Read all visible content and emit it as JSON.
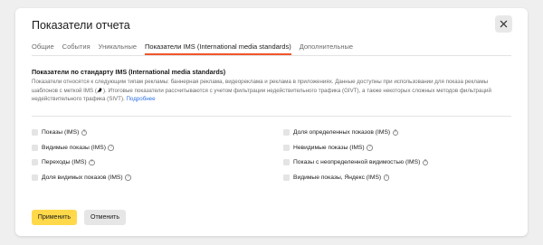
{
  "dialog": {
    "title": "Показатели отчета",
    "close_icon": "close-icon"
  },
  "tabs": [
    {
      "label": "Общие",
      "active": false
    },
    {
      "label": "События",
      "active": false
    },
    {
      "label": "Уникальные",
      "active": false
    },
    {
      "label": "Показатели IMS (International media standards)",
      "active": true
    },
    {
      "label": "Дополнительные",
      "active": false
    }
  ],
  "section": {
    "title": "Показатели по стандарту IMS (International media standards)",
    "description_part1": "Показатели относятся к следующим типам рекламы: баннерная реклама, видеореклама и реклама в приложениях. Данные доступны при использовании для показа рекламы шаблонов с меткой IMS (",
    "description_mark_icon": "ims-mark-icon",
    "description_part2": "). Итоговые показатели рассчитываются с учетом фильтрации недействительного трафика (GIVT), а также некоторых сложных методов фильтраций недействительного трафика (SIVT).",
    "link_label": "Подробнее"
  },
  "options_left": [
    {
      "label": "Показы (IMS)",
      "checked": false
    },
    {
      "label": "Видимые показы (IMS)",
      "checked": false
    },
    {
      "label": "Переходы (IMS)",
      "checked": false
    },
    {
      "label": "Доля видимых показов (IMS)",
      "checked": false
    }
  ],
  "options_right": [
    {
      "label": "Доля определенных показов (IMS)",
      "checked": false
    },
    {
      "label": "Невидимые показы (IMS)",
      "checked": false
    },
    {
      "label": "Показы с неопределенной видимостью (IMS)",
      "checked": false
    },
    {
      "label": "Видимые показы, Яндекс (IMS)",
      "checked": false
    }
  ],
  "buttons": {
    "apply_label": "Применить",
    "cancel_label": "Отменить"
  },
  "colors": {
    "accent_tab_underline": "#f0562c",
    "apply_button": "#ffd94a",
    "link": "#2f72e6"
  }
}
